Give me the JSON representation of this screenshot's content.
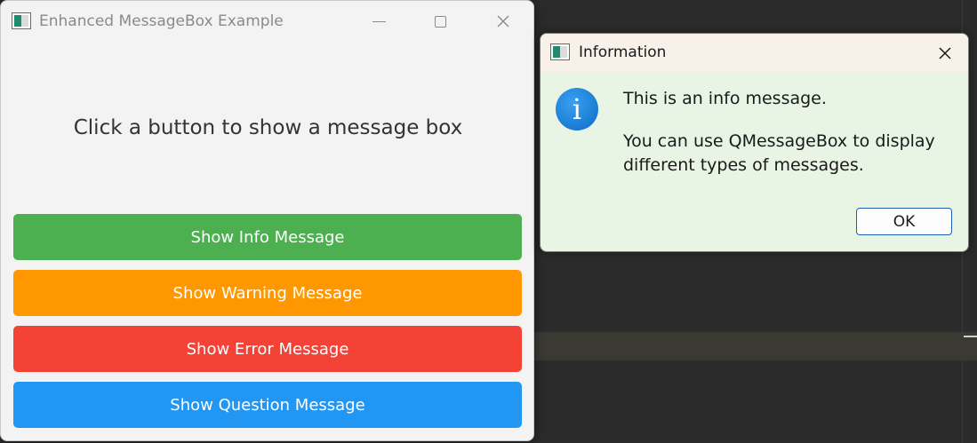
{
  "main_window": {
    "title": "Enhanced MessageBox Example",
    "prompt": "Click a button to show a message box",
    "buttons": {
      "info": {
        "label": "Show Info Message",
        "color": "#4caf50"
      },
      "warning": {
        "label": "Show Warning Message",
        "color": "#ff9800"
      },
      "error": {
        "label": "Show Error Message",
        "color": "#f44336"
      },
      "question": {
        "label": "Show Question Message",
        "color": "#2196f3"
      }
    }
  },
  "dialog": {
    "title": "Information",
    "icon": "info-icon",
    "icon_glyph": "i",
    "message": "This is an info message.",
    "detail": "You can use QMessageBox to display different types of messages.",
    "ok_label": "OK"
  },
  "colors": {
    "dialog_bg": "#e8f5e4",
    "dialog_titlebar_bg": "#f7f1ea",
    "main_bg": "#f3f3f3",
    "desktop_bg": "#2b2b2b"
  }
}
